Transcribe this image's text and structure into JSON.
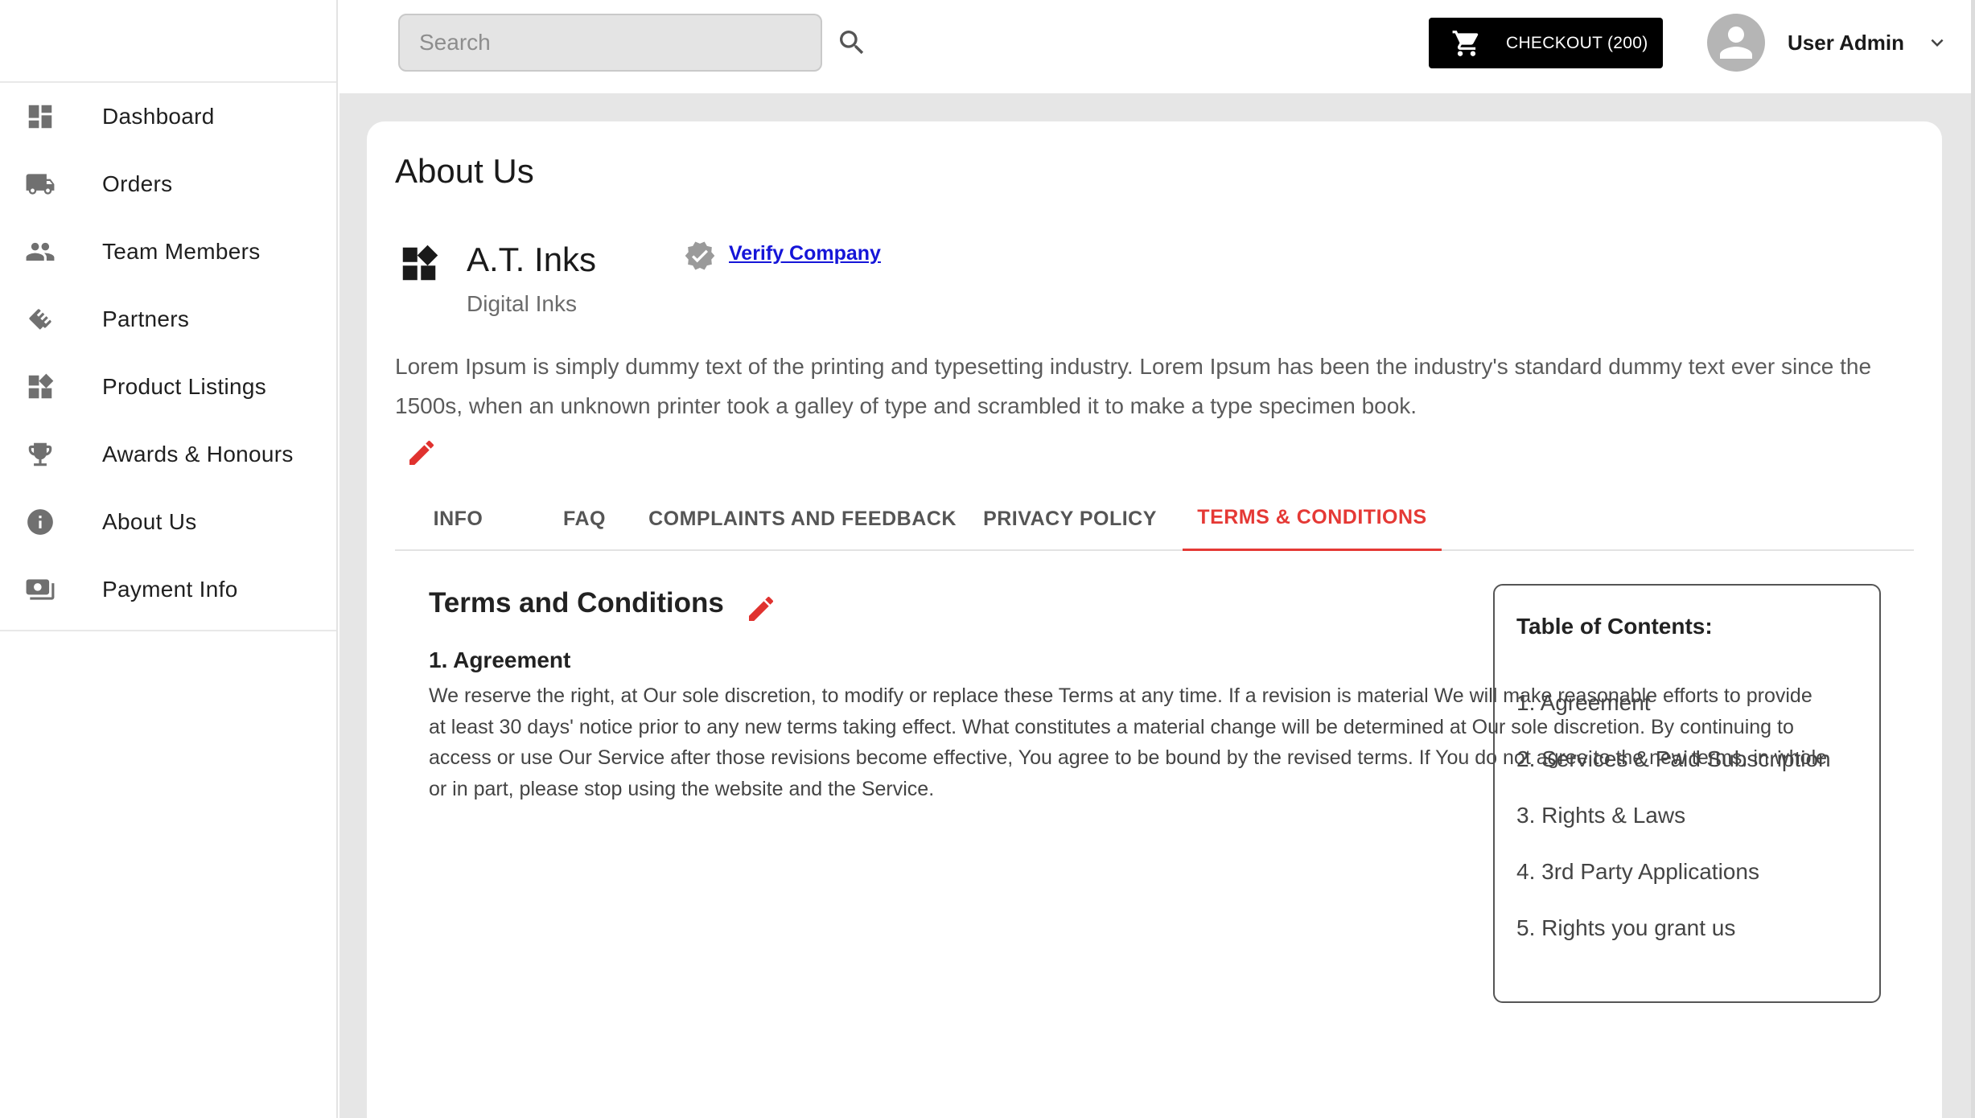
{
  "sidebar": {
    "items": [
      {
        "label": "Dashboard",
        "icon": "dashboard-icon"
      },
      {
        "label": "Orders",
        "icon": "truck-icon"
      },
      {
        "label": "Team Members",
        "icon": "people-icon"
      },
      {
        "label": "Partners",
        "icon": "handshake-icon"
      },
      {
        "label": "Product Listings",
        "icon": "widgets-icon"
      },
      {
        "label": "Awards & Honours",
        "icon": "trophy-icon"
      },
      {
        "label": "About Us",
        "icon": "info-icon"
      },
      {
        "label": "Payment Info",
        "icon": "payment-icon"
      }
    ]
  },
  "header": {
    "search_placeholder": "Search",
    "checkout_label": "CHECKOUT (200)",
    "user_name": "User Admin"
  },
  "page": {
    "title": "About Us",
    "company_name": "A.T. Inks",
    "company_subtitle": "Digital Inks",
    "verify_label": "Verify Company",
    "description": "Lorem Ipsum is simply dummy text of the printing and typesetting industry. Lorem Ipsum has been the industry's standard dummy text ever since the 1500s, when an unknown printer took a galley of type and scrambled it to make a type specimen book."
  },
  "tabs": [
    {
      "label": "INFO"
    },
    {
      "label": "FAQ"
    },
    {
      "label": "COMPLAINTS AND FEEDBACK"
    },
    {
      "label": "PRIVACY POLICY"
    },
    {
      "label": "TERMS & CONDITIONS",
      "active": true
    }
  ],
  "terms": {
    "title": "Terms and Conditions",
    "section_heading": "1. Agreement",
    "section_body": "We reserve the right, at Our sole discretion, to modify or replace these Terms at any time. If a revision is material We will make reasonable efforts to provide at least 30 days' notice prior to any new terms taking effect. What constitutes a material change will be determined at Our sole discretion. By continuing to access or use Our Service after those revisions become effective, You agree to be bound by the revised terms. If You do not agree to the new terms, in whole or in part, please stop using the website and the Service."
  },
  "toc": {
    "title": "Table of Contents:",
    "items": [
      "1. Agreement",
      "2. Services & Paid Subscription",
      "3. Rights & Laws",
      "4. 3rd Party Applications",
      "5. Rights you grant us"
    ]
  },
  "colors": {
    "accent": "#e53935",
    "link": "#1515d8",
    "checkout_bg": "#000000"
  }
}
